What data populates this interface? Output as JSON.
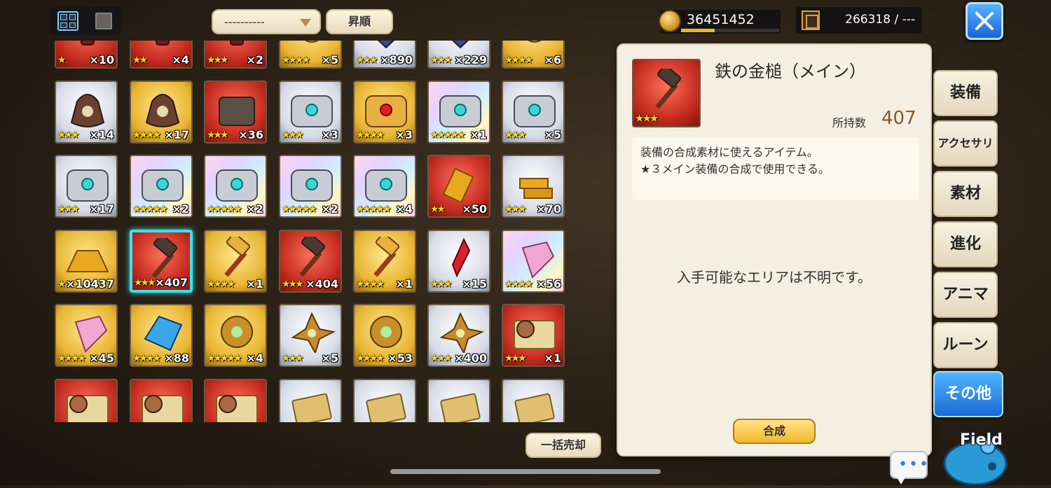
{
  "header": {
    "sort_value": "----------",
    "sort_order_label": "昇順",
    "gold": "36451452",
    "gold_fill": 0.34,
    "storage": "266318 / ---"
  },
  "grid": {
    "items": [
      {
        "name": "red-item",
        "rarity": "red",
        "stars": "★",
        "count": "×10"
      },
      {
        "name": "red-item",
        "rarity": "red",
        "stars": "★★",
        "count": "×4"
      },
      {
        "name": "red-item",
        "rarity": "red",
        "stars": "★★★",
        "count": "×2"
      },
      {
        "name": "gold-item",
        "rarity": "gold",
        "stars": "★★★★",
        "count": "×5"
      },
      {
        "name": "silver-item",
        "rarity": "silver",
        "stars": "★★★",
        "count": "×890"
      },
      {
        "name": "silver-item",
        "rarity": "silver",
        "stars": "★★★",
        "count": "×229"
      },
      {
        "name": "gold-item",
        "rarity": "gold",
        "stars": "★★★★",
        "count": "×6"
      },
      {
        "name": "bag",
        "rarity": "silver",
        "stars": "★★★",
        "count": "×14"
      },
      {
        "name": "bag",
        "rarity": "gold",
        "stars": "★★★★",
        "count": "×17"
      },
      {
        "name": "dark-chest",
        "rarity": "red",
        "stars": "★★★",
        "count": "×36"
      },
      {
        "name": "silver-chest",
        "rarity": "silver",
        "stars": "★★★",
        "count": "×3"
      },
      {
        "name": "gold-chest",
        "rarity": "gold",
        "stars": "★★★★",
        "count": "×3"
      },
      {
        "name": "silver-chest",
        "rarity": "rainbow",
        "stars": "★★★★★",
        "count": "×1"
      },
      {
        "name": "silver-chest",
        "rarity": "silver",
        "stars": "★★★",
        "count": "×5"
      },
      {
        "name": "silver-chest",
        "rarity": "silver",
        "stars": "★★★",
        "count": "×17"
      },
      {
        "name": "silver-chest",
        "rarity": "rainbow",
        "stars": "★★★★★",
        "count": "×2"
      },
      {
        "name": "silver-chest",
        "rarity": "rainbow",
        "stars": "★★★★★",
        "count": "×2"
      },
      {
        "name": "silver-chest",
        "rarity": "rainbow",
        "stars": "★★★★★",
        "count": "×2"
      },
      {
        "name": "silver-chest",
        "rarity": "rainbow",
        "stars": "★★★★★",
        "count": "×4"
      },
      {
        "name": "gold-ingot",
        "rarity": "red",
        "stars": "★★",
        "count": "×50"
      },
      {
        "name": "gold-ingots",
        "rarity": "silver",
        "stars": "★★★",
        "count": "×70"
      },
      {
        "name": "gold-ingot-pile",
        "rarity": "gold",
        "stars": "★",
        "count": "×10437"
      },
      {
        "name": "iron-hammer",
        "rarity": "red",
        "stars": "★★★",
        "count": "×407",
        "selected": true
      },
      {
        "name": "gold-hammer",
        "rarity": "gold",
        "stars": "★★★★",
        "count": "×1"
      },
      {
        "name": "iron-hammer",
        "rarity": "red",
        "stars": "★★★",
        "count": "×404"
      },
      {
        "name": "gold-hammer",
        "rarity": "gold",
        "stars": "★★★★",
        "count": "×1"
      },
      {
        "name": "red-crystal",
        "rarity": "silver",
        "stars": "★★★",
        "count": "×15"
      },
      {
        "name": "pink-crystal",
        "rarity": "rainbow",
        "stars": "★★★★",
        "count": "×56"
      },
      {
        "name": "pink-crystal",
        "rarity": "gold",
        "stars": "★★★★",
        "count": "×45"
      },
      {
        "name": "blue-crystal",
        "rarity": "gold",
        "stars": "★★★★",
        "count": "×88"
      },
      {
        "name": "sun-gem",
        "rarity": "gold",
        "stars": "★★★★★",
        "count": "×4"
      },
      {
        "name": "star-gem",
        "rarity": "silver",
        "stars": "★★★",
        "count": "×5"
      },
      {
        "name": "sun-gem",
        "rarity": "gold",
        "stars": "★★★★",
        "count": "×53"
      },
      {
        "name": "star-gem",
        "rarity": "silver",
        "stars": "★★★",
        "count": "×400"
      },
      {
        "name": "scroll-doll",
        "rarity": "red",
        "stars": "★★★",
        "count": "×1"
      },
      {
        "name": "scroll-doll",
        "rarity": "red",
        "stars": "",
        "count": ""
      },
      {
        "name": "scroll-doll",
        "rarity": "red",
        "stars": "",
        "count": ""
      },
      {
        "name": "scroll-doll",
        "rarity": "red",
        "stars": "",
        "count": ""
      },
      {
        "name": "ticket",
        "rarity": "silver",
        "stars": "",
        "count": ""
      },
      {
        "name": "ticket",
        "rarity": "silver",
        "stars": "",
        "count": ""
      },
      {
        "name": "ticket",
        "rarity": "silver",
        "stars": "",
        "count": ""
      },
      {
        "name": "ticket",
        "rarity": "silver",
        "stars": "",
        "count": ""
      }
    ]
  },
  "sell_all_label": "一括売却",
  "detail": {
    "name": "鉄の金槌（メイン）",
    "stars": "★★★",
    "owned_label": "所持数",
    "owned_value": "407",
    "desc_line1": "装備の合成素材に使えるアイテム。",
    "desc_line2": "★３メイン装備の合成で使用できる。",
    "area": "入手可能なエリアは不明です。",
    "synth_label": "合成"
  },
  "tabs": [
    {
      "label": "装備"
    },
    {
      "label": "アクセサリ"
    },
    {
      "label": "素材"
    },
    {
      "label": "進化"
    },
    {
      "label": "アニマ"
    },
    {
      "label": "ルーン"
    },
    {
      "label": "その他",
      "active": true
    }
  ],
  "field_label": "Field",
  "colors": {
    "accent_blue": "#1a6ad8",
    "star_yellow": "#ffd21a",
    "selection": "#3fe0e8"
  }
}
